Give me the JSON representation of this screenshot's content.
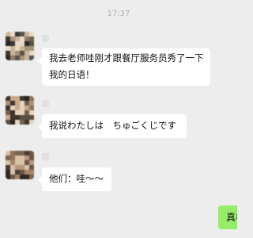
{
  "chat": {
    "timestamp": "17:37",
    "messages": [
      {
        "from": "other",
        "lines": [
          "我去老师哇刚才跟餐厅服务员秀了一下",
          "我的日语！"
        ]
      },
      {
        "from": "other",
        "lines": [
          "我说わたしは　ちゅごくじです"
        ]
      },
      {
        "from": "other",
        "lines": [
          "他们：哇～～"
        ]
      },
      {
        "from": "self",
        "text": "真棒"
      }
    ]
  },
  "colors": {
    "background": "#ededed",
    "incoming_bubble": "#ffffff",
    "outgoing_bubble": "#95ec69",
    "timestamp_text": "#b2b2b2"
  }
}
